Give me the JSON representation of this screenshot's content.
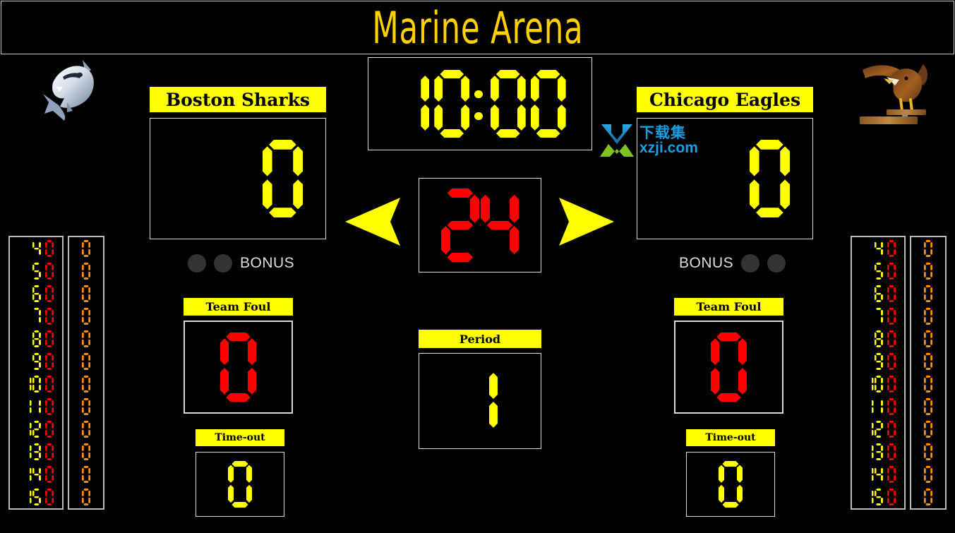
{
  "app": {
    "title": "Marine Arena",
    "title_color": "#ffd100",
    "background": "#000000",
    "accent_yellow": "#ffff00",
    "accent_red": "#ff0000",
    "accent_orange": "#ff9000"
  },
  "game_clock": {
    "label": "game-clock",
    "value": "10:00",
    "color": "#ffff00"
  },
  "shot_clock": {
    "label": "shot-clock",
    "value": "24",
    "color": "#ff0000"
  },
  "period": {
    "label": "Period",
    "value": "1",
    "color": "#ffff00"
  },
  "possession": {
    "left_arrow": "left-arrow",
    "right_arrow": "right-arrow",
    "color": "#ffff00"
  },
  "home": {
    "name": "Boston Sharks",
    "logo": "shark-logo",
    "score": "0",
    "score_color": "#ffff00",
    "bonus_label": "BONUS",
    "bonus_lit": [
      false,
      false
    ],
    "team_foul_label": "Team Foul",
    "team_foul_value": "0",
    "team_foul_color": "#ff0000",
    "timeout_label": "Time-out",
    "timeout_value": "0",
    "timeout_color": "#ffff00",
    "players": [
      {
        "number": "4",
        "fouls": "0",
        "points": "0"
      },
      {
        "number": "5",
        "fouls": "0",
        "points": "0"
      },
      {
        "number": "6",
        "fouls": "0",
        "points": "0"
      },
      {
        "number": "7",
        "fouls": "0",
        "points": "0"
      },
      {
        "number": "8",
        "fouls": "0",
        "points": "0"
      },
      {
        "number": "9",
        "fouls": "0",
        "points": "0"
      },
      {
        "number": "10",
        "fouls": "0",
        "points": "0"
      },
      {
        "number": "11",
        "fouls": "0",
        "points": "0"
      },
      {
        "number": "12",
        "fouls": "0",
        "points": "0"
      },
      {
        "number": "13",
        "fouls": "0",
        "points": "0"
      },
      {
        "number": "14",
        "fouls": "0",
        "points": "0"
      },
      {
        "number": "15",
        "fouls": "0",
        "points": "0"
      }
    ]
  },
  "away": {
    "name": "Chicago Eagles",
    "logo": "eagle-logo",
    "score": "0",
    "score_color": "#ffff00",
    "bonus_label": "BONUS",
    "bonus_lit": [
      false,
      false
    ],
    "team_foul_label": "Team Foul",
    "team_foul_value": "0",
    "team_foul_color": "#ff0000",
    "timeout_label": "Time-out",
    "timeout_value": "0",
    "timeout_color": "#ffff00",
    "players": [
      {
        "number": "4",
        "fouls": "0",
        "points": "0"
      },
      {
        "number": "5",
        "fouls": "0",
        "points": "0"
      },
      {
        "number": "6",
        "fouls": "0",
        "points": "0"
      },
      {
        "number": "7",
        "fouls": "0",
        "points": "0"
      },
      {
        "number": "8",
        "fouls": "0",
        "points": "0"
      },
      {
        "number": "9",
        "fouls": "0",
        "points": "0"
      },
      {
        "number": "10",
        "fouls": "0",
        "points": "0"
      },
      {
        "number": "11",
        "fouls": "0",
        "points": "0"
      },
      {
        "number": "12",
        "fouls": "0",
        "points": "0"
      },
      {
        "number": "13",
        "fouls": "0",
        "points": "0"
      },
      {
        "number": "14",
        "fouls": "0",
        "points": "0"
      },
      {
        "number": "15",
        "fouls": "0",
        "points": "0"
      }
    ]
  },
  "watermark": {
    "cn": "下载集",
    "en": "xzji.com",
    "color": "#1a9fe0"
  }
}
